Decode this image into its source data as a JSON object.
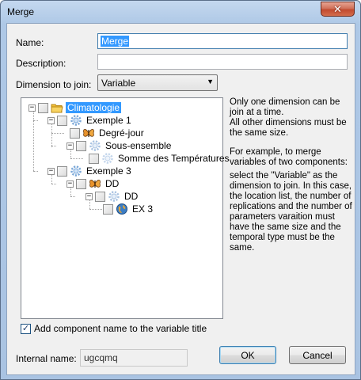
{
  "window": {
    "title": "Merge",
    "close_glyph": "✕"
  },
  "form": {
    "name_label": "Name:",
    "name_value": "Merge",
    "description_label": "Description:",
    "description_value": "",
    "dimension_label": "Dimension to join:",
    "dimension_value": "Variable",
    "add_component_label": "Add component name to the variable title",
    "add_component_checked": true,
    "internal_name_label": "Internal name:",
    "internal_name_value": "ugcqmq"
  },
  "tree": {
    "nodes": [
      {
        "label": "Climatologie",
        "icon": "folder-icon",
        "expanded": true,
        "selected": true
      },
      {
        "label": "Exemple  1",
        "icon": "gear-icon",
        "expanded": true
      },
      {
        "label": "Degré-jour",
        "icon": "butterfly-icon"
      },
      {
        "label": "Sous-ensemble",
        "icon": "gear-icon",
        "expanded": true
      },
      {
        "label": "Somme des Températures",
        "icon": "gear-icon"
      },
      {
        "label": "Exemple 3",
        "icon": "gear-icon",
        "expanded": true
      },
      {
        "label": "DD",
        "icon": "butterfly-icon",
        "expanded": true
      },
      {
        "label": "DD",
        "icon": "gear-icon",
        "expanded": true
      },
      {
        "label": "EX 3",
        "icon": "globe-icon"
      }
    ]
  },
  "info": {
    "para1": "Only one dimension can be join at a time.\nAll other dimensions must be the same size.",
    "para2": "For example, to merge variables of two components:",
    "para3": "select the \"Variable\" as the dimension to join. In this case, the location list, the number of replications and the number of parameters varaition must have the same size and the temporal type must be the same."
  },
  "buttons": {
    "ok": "OK",
    "cancel": "Cancel"
  },
  "colors": {
    "selection": "#3399ff",
    "title_bar": "#aec8e6",
    "close": "#c24a2f"
  }
}
